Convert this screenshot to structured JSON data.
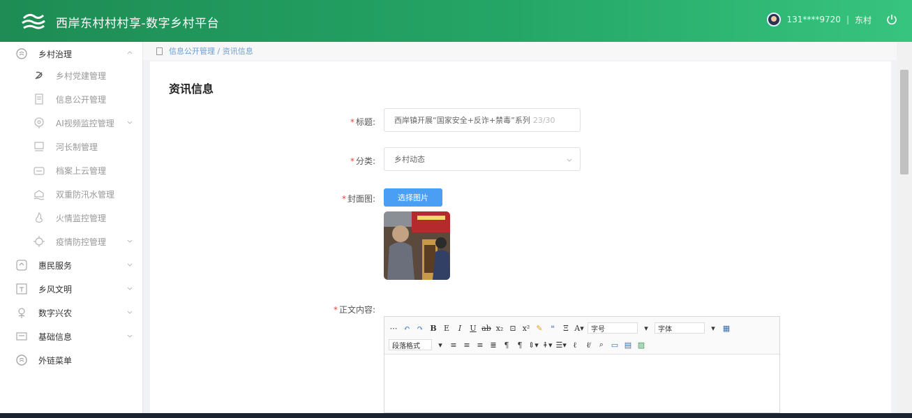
{
  "header": {
    "title": "西岸东村村村享-数字乡村平台",
    "user": "131****9720",
    "separator": "|",
    "org": "东村"
  },
  "sidebar": {
    "items": [
      {
        "label": "乡村治理",
        "icon": "governance-icon",
        "sub": false,
        "chevron": "up"
      },
      {
        "label": "乡村党建管理",
        "icon": "party-icon",
        "sub": true
      },
      {
        "label": "信息公开管理",
        "icon": "document-icon",
        "sub": true
      },
      {
        "label": "AI视频监控管理",
        "icon": "camera-icon",
        "sub": true,
        "chevron": "down"
      },
      {
        "label": "河长制管理",
        "icon": "river-icon",
        "sub": true
      },
      {
        "label": "档案上云管理",
        "icon": "cloud-archive-icon",
        "sub": true
      },
      {
        "label": "双重防汛水管理",
        "icon": "flood-icon",
        "sub": true
      },
      {
        "label": "火情监控管理",
        "icon": "fire-icon",
        "sub": true
      },
      {
        "label": "疫情防控管理",
        "icon": "epidemic-icon",
        "sub": true,
        "chevron": "down"
      },
      {
        "label": "惠民服务",
        "icon": "service-icon",
        "sub": false,
        "chevron": "down"
      },
      {
        "label": "乡风文明",
        "icon": "civilization-icon",
        "sub": false,
        "chevron": "down"
      },
      {
        "label": "数字兴农",
        "icon": "agriculture-icon",
        "sub": false,
        "chevron": "down"
      },
      {
        "label": "基础信息",
        "icon": "info-icon",
        "sub": false,
        "chevron": "down"
      },
      {
        "label": "外链菜单",
        "icon": "link-icon",
        "sub": false
      }
    ]
  },
  "breadcrumb": "信息公开管理 / 资讯信息",
  "form": {
    "page_title": "资讯信息",
    "title_label": "标题:",
    "title_value": "西岸镇开展“国家安全+反诈+禁毒”系列",
    "title_count": "23/30",
    "category_label": "分类:",
    "category_value": "乡村动态",
    "cover_label": "封面图:",
    "choose_image_button": "选择图片",
    "body_label": "正文内容:"
  },
  "editor": {
    "font_size_select": "字号",
    "font_family_select": "字体",
    "paragraph_select": "段落格式"
  },
  "colors": {
    "header_start": "#1e8c54",
    "header_end": "#37c47e",
    "primary_button": "#4a9ff5",
    "required": "#e64340"
  }
}
